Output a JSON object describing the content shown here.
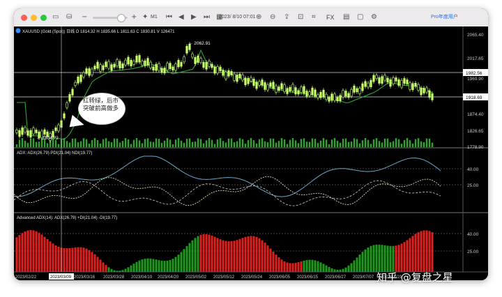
{
  "toolbar": {
    "window_controls": [
      "close",
      "minimize",
      "zoom"
    ],
    "icons": [
      "sidebar-icon",
      "database-icon",
      "minus-icon",
      "plus-icon",
      "crosshair-icon",
      "skip-start-icon",
      "step-back-icon",
      "play-icon",
      "step-forward-icon",
      "calendar-icon"
    ],
    "timeframe": "M1",
    "datetime": "2023/ 8/10 07:01",
    "right_icons": [
      "zoom-in-icon",
      "zoom-out-icon",
      "export-icon",
      "screenshot-icon",
      "indicator-icon",
      "fx-icon",
      "layout-icon",
      "chat-icon",
      "settings-icon"
    ],
    "fx_label": "FX",
    "pro_label": "Pro年度用户"
  },
  "main_panel": {
    "info": "XAUUSD (Gold (Spot)) 日线  O  1814.32  H  1835.66  L  1811.63  C  1830.81  V  126471",
    "price_labels": [
      "2065.40",
      "2017.65",
      "1969.90",
      "1922.14",
      "1874.40",
      "1826.65",
      "1778.90"
    ],
    "badge_high": "1982.56",
    "badge_current": "1918.69",
    "high_annotation": "← 2062.91",
    "low_annotation": "← 1804.72",
    "colors": {
      "candle": "#c8ff6a",
      "ma": "#2db52d",
      "badge": "#ffffff"
    }
  },
  "adx_panel": {
    "info": "ADX: ADX(26.79) PDI(21.04) NDI(19.77)",
    "levels": [
      "40.00",
      "25.00"
    ]
  },
  "adv_panel": {
    "info": "Advanced ADX(14): ADX(26.79) +DI(21.04) -DI(19.77)",
    "levels": [
      "40.00",
      "25.00"
    ],
    "colors": {
      "up": "#1b9a1b",
      "down": "#e0201f"
    }
  },
  "x_axis": {
    "labels": [
      "2023/02/22",
      "2023/03/06",
      "2023/03/16",
      "2023/03/28",
      "2023/04/10",
      "2023/04/20",
      "2023/05/02",
      "2023/05/12",
      "2023/05/24",
      "2023/06/05",
      "2023/06/15",
      "2023/06/27",
      "2023/07/07",
      "2023/07/19"
    ],
    "cursor_label": "2023/03/09"
  },
  "annotation": {
    "text": "红转绿，后市突破前高做多"
  },
  "watermark": "知乎 @复盘之星"
}
